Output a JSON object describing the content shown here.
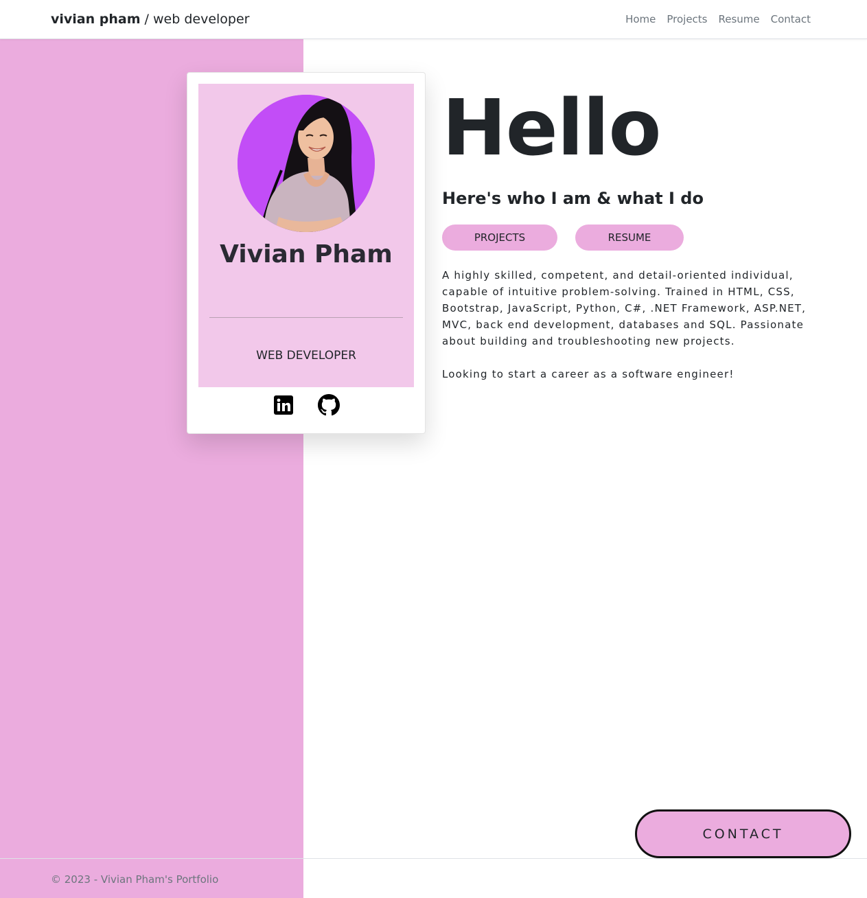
{
  "navbar": {
    "brand_name": "vivian pham",
    "brand_tagline": " / web developer",
    "links": [
      "Home",
      "Projects",
      "Resume",
      "Contact"
    ]
  },
  "card": {
    "name": "Vivian Pham",
    "role": "WEB DEVELOPER",
    "avatar_alt": "photo of Vivian Pham",
    "social": [
      {
        "icon": "linkedin-icon",
        "label": "LinkedIn"
      },
      {
        "icon": "github-icon",
        "label": "GitHub"
      }
    ]
  },
  "hero": {
    "heading": "Hello",
    "subtitle": "Here's who I am & what I do",
    "buttons": [
      "PROJECTS",
      "RESUME"
    ],
    "about": "A highly skilled, competent, and detail-oriented individual, capable of intuitive problem-solving. Trained in HTML, CSS, Bootstrap, JavaScript, Python, C#, .NET Framework, ASP.NET, MVC, back end development, databases and SQL. Passionate about building and troubleshooting new projects.",
    "goal": "Looking to start a career as a software engineer!"
  },
  "contact_button": "CONTACT",
  "footer": {
    "text": "© 2023 - Vivian Pham's Portfolio"
  },
  "colors": {
    "accent_pink": "#ebacde",
    "card_pink": "#f2c8ea",
    "avatar_purple": "#c24df7",
    "text_dark": "#212529",
    "muted": "#6c757d"
  }
}
